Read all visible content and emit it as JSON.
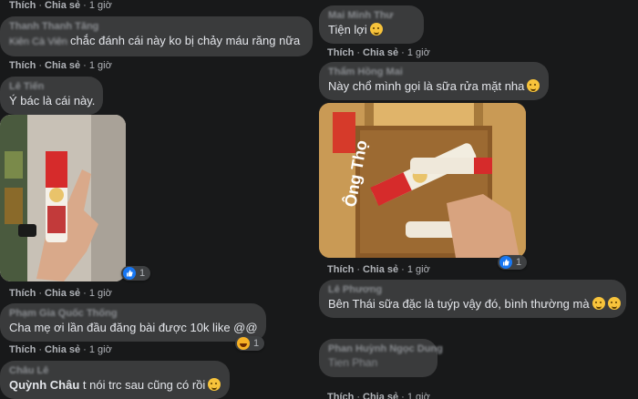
{
  "actions": {
    "like": "Thích",
    "share": "Chia sẻ",
    "sep": "·",
    "time": "1 giờ"
  },
  "left": {
    "c1": {
      "author": "Thanh Thanh Tăng",
      "tag": "Kiên Cà Viên",
      "text": "chắc đánh cái này ko bị chảy máu răng nữa"
    },
    "c2": {
      "author": "Lê Tiến",
      "text": "Ý bác là cái này."
    },
    "c2_react": "1",
    "c3": {
      "author": "Phạm Gia Quốc Thống",
      "text": "Cha mẹ ơi lần đầu đăng bài được 10k like @@"
    },
    "c3_react": "1",
    "c4": {
      "author": "Châu Lê",
      "name": "Quỳnh Châu",
      "text": "t nói trc sau cũng có rồi"
    }
  },
  "right": {
    "c1": {
      "author": "Mai Minh Thư",
      "text": "Tiện lợi"
    },
    "c2": {
      "author": "Thẩm Hồng Mai",
      "text": "Này chổ mình gọi là sữa rửa mặt nha"
    },
    "photo_react": "1",
    "c3": {
      "author": "Lê Phương",
      "text": "Bên Thái sữa đặc là tuýp vậy đó, bình thường mà"
    },
    "c4": {
      "author": "Phan Huỳnh Ngọc Dung",
      "line2": "Tien Phan"
    }
  },
  "product_label": "Ông Thọ",
  "colors": {
    "bg": "#18191a",
    "bubble": "#3a3b3c",
    "muted": "#b0b3b8",
    "like": "#1877f2"
  }
}
